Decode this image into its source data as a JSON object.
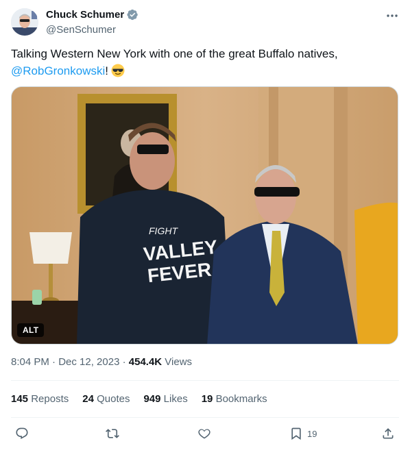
{
  "user": {
    "display_name": "Chuck Schumer",
    "handle": "@SenSchumer"
  },
  "tweet": {
    "text_before": "Talking Western New York with one of the great Buffalo natives,",
    "mention": "@RobGronkowski",
    "text_after": "!"
  },
  "media": {
    "alt_badge": "ALT",
    "sweatshirt_line1": "FIGHT",
    "sweatshirt_line2": "VALLEY",
    "sweatshirt_line3": "FEVER"
  },
  "meta": {
    "time": "8:04 PM · Dec 12, 2023 · ",
    "views_count": "454.4K",
    "views_label": " Views"
  },
  "stats": {
    "reposts_count": "145",
    "reposts_label": "Reposts",
    "quotes_count": "24",
    "quotes_label": "Quotes",
    "likes_count": "949",
    "likes_label": "Likes",
    "bookmarks_count": "19",
    "bookmarks_label": "Bookmarks"
  },
  "actions": {
    "bookmark_count": "19"
  },
  "colors": {
    "link": "#1d9bf0",
    "secondary_text": "#536471",
    "primary_text": "#0f1419",
    "verified": "#829aab"
  }
}
